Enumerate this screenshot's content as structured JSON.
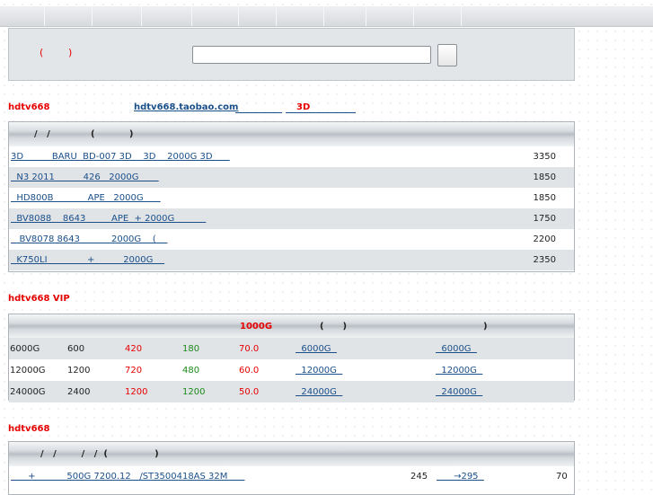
{
  "search": {
    "paren_open": "(",
    "paren_close": ")",
    "input_value": ""
  },
  "section1": {
    "label": "hdtv668",
    "link": "hdtv668.taobao.com",
    "red_text": "3D",
    "table_header": "/   /             (           )",
    "rows": [
      {
        "name": "3D          BARU  BD-007 3D    3D    2000G 3D      ",
        "price": "3350"
      },
      {
        "name": "  N3 2011          426   2000G       ",
        "price": "1850"
      },
      {
        "name": "  HD800B            APE   2000G      ",
        "price": "1850"
      },
      {
        "name": "  BV8088    8643         APE  + 2000G           ",
        "price": "1750"
      },
      {
        "name": "   BV8078 8643           2000G    (    ",
        "price": "2200"
      },
      {
        "name": "  K750LI              +          2000G    ",
        "price": "2350"
      }
    ]
  },
  "section2": {
    "label": "hdtv668 VIP",
    "header_red": "1000G",
    "header_mid": "(      )",
    "header_right": ")",
    "rows": [
      {
        "cap": "6000G",
        "a": "600",
        "b": "420",
        "c": "180",
        "d": "70.0",
        "link1": "  6000G  ",
        "link2": "  6000G  "
      },
      {
        "cap": "12000G",
        "a": "1200",
        "b": "720",
        "c": "480",
        "d": "60.0",
        "link1": "  12000G  ",
        "link2": "  12000G  "
      },
      {
        "cap": "24000G",
        "a": "2400",
        "b": "1200",
        "c": "1200",
        "d": "50.0",
        "link1": "  24000G  ",
        "link2": "  24000G  "
      }
    ]
  },
  "section3": {
    "label": "hdtv668",
    "table_header": "/   /        /   /  (               )",
    "row": {
      "name": "      +           500G 7200.12   /ST3500418AS 32M      ",
      "num1": "245",
      "link": "      →295  ",
      "num2": "70"
    }
  }
}
